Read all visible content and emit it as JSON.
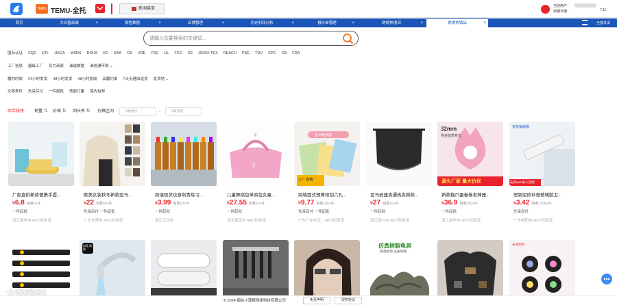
{
  "header": {
    "temu_badge": "TEMU",
    "app_name": "TEMU-全托",
    "new_button": "新闻菜单",
    "user_line1": "当前用户：",
    "user_line2": "到期日期：",
    "date_suffix": "7:11"
  },
  "tabs": [
    {
      "label": "首页",
      "closable": false
    },
    {
      "label": "大白菌商城",
      "closable": true
    },
    {
      "label": "销售数据",
      "closable": true
    },
    {
      "label": "店铺管理",
      "closable": true
    },
    {
      "label": "历史利润分析",
      "closable": true
    },
    {
      "label": "报价单管理",
      "closable": true
    },
    {
      "label": "跨境热搜词",
      "closable": true
    },
    {
      "label": "跨境热销品",
      "closable": true,
      "active": true
    }
  ],
  "tabs_menu": "全部关闭",
  "search": {
    "placeholder": "请输入您要搜索的关键词..."
  },
  "filters": {
    "cert": [
      "国际认证",
      "CQC",
      "ETL",
      "UKCA",
      "MSDS",
      "ROHS",
      "KC",
      "SAA",
      "GS",
      "VDE",
      "FSC",
      "UL",
      "FCC",
      "CE",
      "OEKO-TEX",
      "REACH",
      "PSE",
      "TÜV",
      "CPC",
      "CB",
      "FDA"
    ],
    "factory": [
      "工厂信息",
      "超级工厂",
      "实力商家",
      "诚选数据",
      "诚信通年限 ⌄"
    ],
    "delivery": [
      "履约时效",
      "24小时发货",
      "48小时发货",
      "48小时揽收",
      "高履约率",
      "7天无理由退货",
      "发货地 ⌄"
    ],
    "trade": [
      "交易条件",
      "先采后付",
      "一件起批",
      "低起订量",
      "境内包邮"
    ]
  },
  "sort": {
    "items": [
      "综合排序",
      "销量 ⇅",
      "价格 ⇅",
      "回头率 ⇅",
      "价格区间"
    ],
    "price_min_placeholder": "¥最低价",
    "price_max_placeholder": "¥最高价",
    "dash": "-"
  },
  "products": [
    {
      "title": "厂家直供新款便携手提...",
      "currency": "¥",
      "price": "6.8",
      "sold": "销量0+件",
      "tag": "一件起批",
      "location": "浙江金华市 48小时发货"
    },
    {
      "title": "欧美女装秋冬新款亚马...",
      "currency": "¥",
      "price": "22",
      "sold": "销量50+件",
      "tag": "先采后付 一件起批",
      "location": "广东东莞市 48小时发货"
    },
    {
      "title": "跨境现货纹身刺青练习...",
      "currency": "¥",
      "price": "3.99",
      "sold": "销量10+件",
      "tag": "一件起批",
      "location": "浙江义乌市"
    },
    {
      "title": "儿童舞蹈包单肩包女童...",
      "currency": "¥",
      "price": "27.55",
      "sold": "销量10+件",
      "tag": "一件起批",
      "location": "河北保定市 48小时发货"
    },
    {
      "title": "跨境西式预算规划六孔...",
      "currency": "¥",
      "price": "9.77",
      "sold": "销量100+件",
      "tag": "先采后付 一件起批",
      "location": "广东广州市天... 48小时发货"
    },
    {
      "title": "亚马逊速卖通热卖新款...",
      "currency": "¥",
      "price": "27",
      "sold": "销量10+件",
      "tag": "一件起批",
      "location": "浙江绍兴市 48小时发货"
    },
    {
      "title": "新款猫爪蛋卷卷发神器...",
      "currency": "¥",
      "price": "36.9",
      "sold": "销量200+件",
      "tag": "一件起批",
      "location": "浙江金华市 48小时发货"
    },
    {
      "title": "塑钢泥修补膏玻璃胶卫...",
      "currency": "¥",
      "price": "3.42",
      "sold": "销量1700+件",
      "tag": "先采后付",
      "location": "广东揭阳市 48小时发货"
    }
  ],
  "product_image_text": {
    "p5_top": "色卡纸张贴",
    "p5_bottom": "工厂 直销",
    "p7_top": "32mm",
    "p7_sub": "陶瓷基质卷发",
    "p7_banner": "源头厂家 量大价优",
    "p8_top": "天花板缝隙",
    "p8_banner": "支持oem私人定制",
    "r2_1": "",
    "r2_2": "抖音 同款",
    "r2_6_top": "仿真树脂龟洞",
    "r2_6_sub": "[树脂新款 品质保障]",
    "r2_8_top": "支持定制"
  },
  "footer": {
    "copyright": "© 2024 烟台小蓝鲸网络科技有限公司",
    "disclaimer": "免责声明",
    "agreement": "授权协议"
  },
  "watermark": "大数跨境",
  "colors": {
    "accent": "#e8232e",
    "tabbar": "#1a56b8",
    "temu": "#f37021"
  }
}
